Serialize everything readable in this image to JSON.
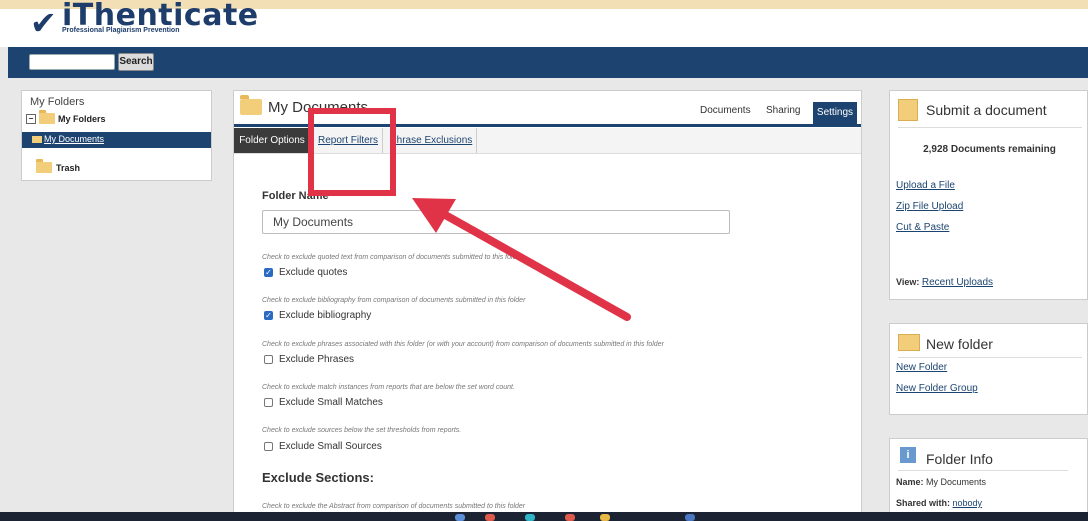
{
  "brand": {
    "logo_word": "iThenticate",
    "tagline": "Professional Plagiarism Prevention"
  },
  "navbar": {
    "search_placeholder": "",
    "search_button": "Search"
  },
  "left_panel": {
    "title": "My Folders",
    "tree_root": "My Folders",
    "selected_item": "My Documents",
    "trash": "Trash"
  },
  "center": {
    "title": "My Documents",
    "tabs": [
      "Documents",
      "Sharing",
      "Settings"
    ],
    "subtabs": [
      "Folder Options",
      "Report Filters",
      "Phrase Exclusions"
    ],
    "folder_name_label": "Folder Name",
    "folder_name_value": "My Documents",
    "options": [
      {
        "hint": "Check to exclude quoted text from comparison of documents submitted to this folder",
        "label": "Exclude quotes",
        "checked": true
      },
      {
        "hint": "Check to exclude bibliography from comparison of documents submitted in this folder",
        "label": "Exclude bibliography",
        "checked": true
      },
      {
        "hint": "Check to exclude phrases associated with this folder (or with your account) from comparison of documents submitted in this folder",
        "label": "Exclude Phrases",
        "checked": false
      },
      {
        "hint": "Check to exclude match instances from reports that are below the set word count.",
        "label": "Exclude Small Matches",
        "checked": false
      },
      {
        "hint": "Check to exclude sources below the set thresholds from reports.",
        "label": "Exclude Small Sources",
        "checked": false
      }
    ],
    "exclude_sections_heading": "Exclude Sections:",
    "abstract_hint": "Check to exclude the Abstract from comparison of documents submitted to this folder"
  },
  "submit_panel": {
    "title": "Submit a document",
    "remaining": "2,928 Documents remaining",
    "links": [
      "Upload a File",
      "Zip File Upload",
      "Cut & Paste"
    ],
    "view_label": "View:",
    "view_link": "Recent Uploads"
  },
  "new_folder_panel": {
    "title": "New folder",
    "links": [
      "New Folder",
      "New Folder Group"
    ]
  },
  "folder_info_panel": {
    "title": "Folder Info",
    "name_label": "Name:",
    "name_value": "My Documents",
    "shared_label": "Shared with:",
    "shared_value": "nobody"
  },
  "colors": {
    "navbar": "#1d4470",
    "annotation": "#e03347",
    "folder": "#f2cd7a"
  }
}
